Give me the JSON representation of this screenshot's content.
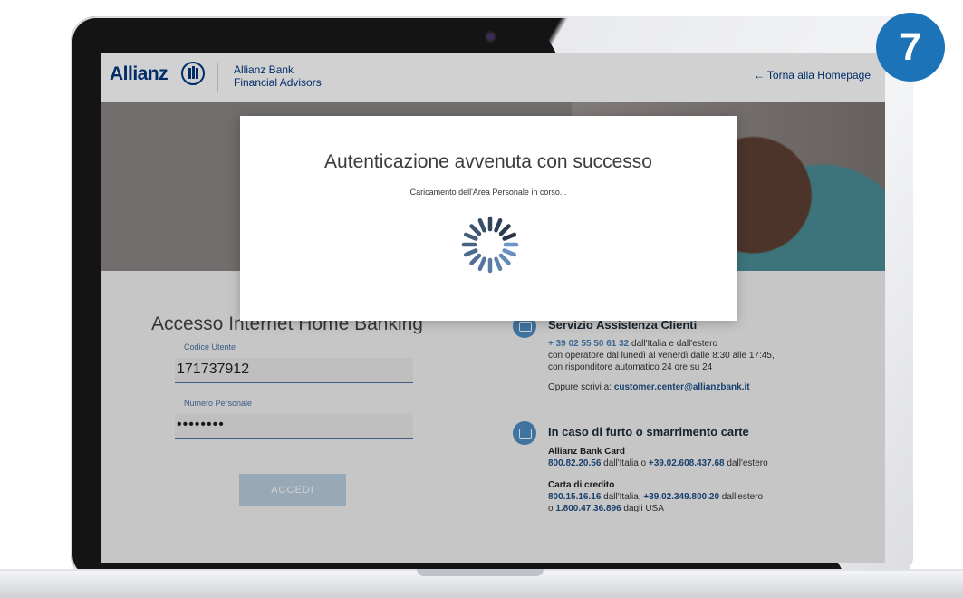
{
  "header": {
    "logo_text": "Allianz",
    "brand_line1": "Allianz Bank",
    "brand_line2": "Financial Advisors",
    "back_link": "← Torna alla Homepage"
  },
  "login": {
    "title": "Accesso Internet Home Banking",
    "user_label": "Codice Utente",
    "user_value": "171737912",
    "pin_label": "Numero Personale",
    "pin_value": "••••••••",
    "submit_label": "ACCEDI"
  },
  "assistance": {
    "title": "Servizio Assistenza Clienti",
    "phone": "+ 39 02 55 50 61 32",
    "phone_suffix": " dall'Italia e dall'estero",
    "line2": "con operatore dal lunedì al venerdì dalle 8:30 alle 17:45,",
    "line3": "con risponditore automatico 24 ore su 24",
    "email_prefix": "Oppure scrivi a: ",
    "email": "customer.center@allianzbank.it"
  },
  "cards": {
    "title": "In caso di furto o smarrimento carte",
    "bank_card_title": "Allianz Bank Card",
    "bank_card_it": "800.82.20.56",
    "bank_card_mid": " dall'Italia o ",
    "bank_card_abroad": "+39.02.608.437.68",
    "bank_card_suffix": " dall'estero",
    "credit_title": "Carta di credito",
    "credit_it": "800.15.16.16",
    "credit_mid": " dall'Italia, ",
    "credit_abroad": "+39.02.349.800.20",
    "credit_suffix": " dall'estero",
    "usa_prefix": "o ",
    "usa_number": "1.800.47.36.896",
    "usa_suffix": " dagli USA"
  },
  "modal": {
    "title": "Autenticazione avvenuta con successo",
    "subtitle": "Caricamento dell'Area Personale in corso..."
  },
  "step_badge": "7",
  "colors": {
    "brand": "#003781",
    "accent": "#1d73b8",
    "button_disabled": "#b9cfe0"
  }
}
